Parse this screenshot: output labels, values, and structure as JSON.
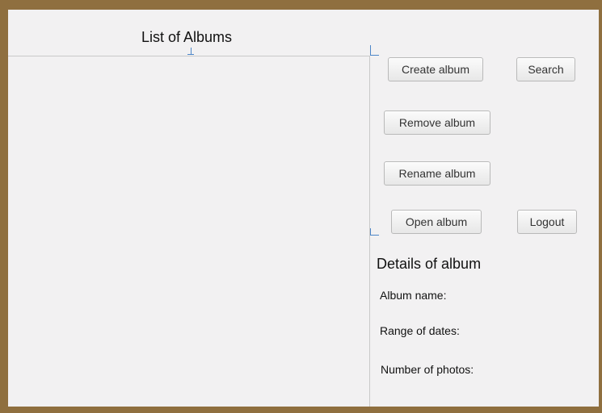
{
  "albums_panel": {
    "title": "List of Albums"
  },
  "actions": {
    "create_album": "Create album",
    "search": "Search",
    "remove_album": "Remove album",
    "rename_album": "Rename album",
    "open_album": "Open album",
    "logout": "Logout"
  },
  "details": {
    "title": "Details of album",
    "album_name_label": "Album name:",
    "range_of_dates_label": "Range of dates:",
    "number_of_photos_label": "Number of photos:"
  }
}
